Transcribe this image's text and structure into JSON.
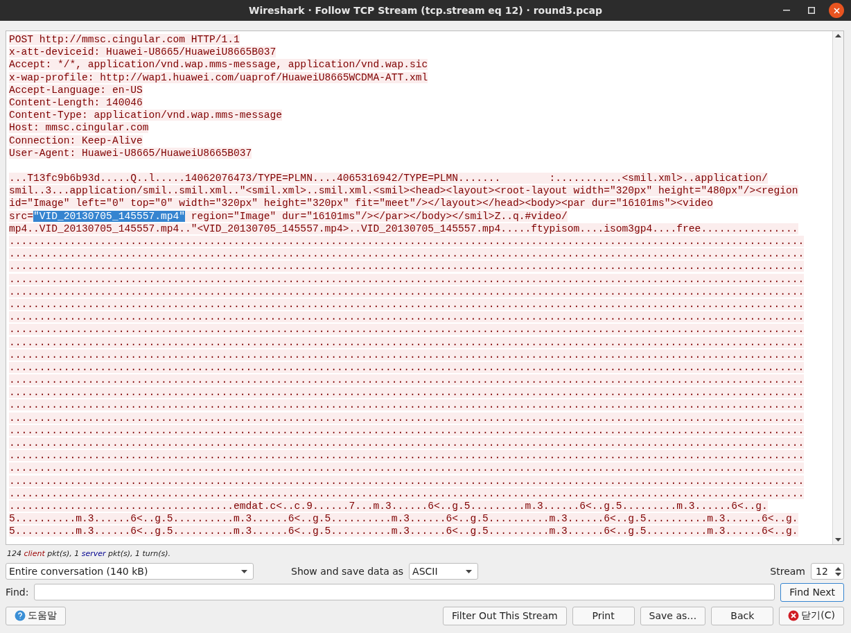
{
  "window": {
    "title": "Wireshark · Follow TCP Stream (tcp.stream eq 12) · round3.pcap"
  },
  "stream_lines": [
    {
      "parts": [
        {
          "text": "POST http://mmsc.cingular.com HTTP/1.1",
          "selected": false
        }
      ]
    },
    {
      "parts": [
        {
          "text": "x-att-deviceid: Huawei-U8665/HuaweiU8665B037",
          "selected": false
        }
      ]
    },
    {
      "parts": [
        {
          "text": "Accept: */*, application/vnd.wap.mms-message, application/vnd.wap.sic",
          "selected": false
        }
      ]
    },
    {
      "parts": [
        {
          "text": "x-wap-profile: http://wap1.huawei.com/uaprof/HuaweiU8665WCDMA-ATT.xml",
          "selected": false
        }
      ]
    },
    {
      "parts": [
        {
          "text": "Accept-Language: en-US",
          "selected": false
        }
      ]
    },
    {
      "parts": [
        {
          "text": "Content-Length: 140046",
          "selected": false
        }
      ]
    },
    {
      "parts": [
        {
          "text": "Content-Type: application/vnd.wap.mms-message",
          "selected": false
        }
      ]
    },
    {
      "parts": [
        {
          "text": "Host: mmsc.cingular.com",
          "selected": false
        }
      ]
    },
    {
      "parts": [
        {
          "text": "Connection: Keep-Alive",
          "selected": false
        }
      ]
    },
    {
      "parts": [
        {
          "text": "User-Agent: Huawei-U8665/HuaweiU8665B037",
          "selected": false
        }
      ]
    },
    {
      "kind": "blank"
    },
    {
      "parts": [
        {
          "text": "...T13fc9b6b93d.....Q..l.....14062076473/TYPE=PLMN....4065316942/TYPE=PLMN.......        :...........<smil.xml>..application/",
          "selected": false
        }
      ]
    },
    {
      "parts": [
        {
          "text": "smil..3...application/smil..smil.xml..\"<smil.xml>..smil.xml.<smil><head><layout><root-layout width=\"320px\" height=\"480px\"/><region",
          "selected": false
        }
      ]
    },
    {
      "parts": [
        {
          "text": "id=\"Image\" left=\"0\" top=\"0\" width=\"320px\" height=\"320px\" fit=\"meet\"/></layout></head><body><par dur=\"16101ms\"><video",
          "selected": false
        }
      ]
    },
    {
      "parts": [
        {
          "text": "src=",
          "selected": false
        },
        {
          "text": "\"VID_20130705_145557.mp4\"",
          "selected": true
        },
        {
          "text": " region=\"Image\" dur=\"16101ms\"/></par></body></smil>Z..q.#video/",
          "selected": false
        }
      ]
    },
    {
      "parts": [
        {
          "text": "mp4..VID_20130705_145557.mp4..\"<VID_20130705_145557.mp4>..VID_20130705_145557.mp4.....ftypisom....isom3gp4....free................",
          "selected": false
        }
      ]
    },
    {
      "parts": [
        {
          "text": "...................................................................................................................................",
          "selected": false
        }
      ]
    },
    {
      "parts": [
        {
          "text": "...................................................................................................................................",
          "selected": false
        }
      ]
    },
    {
      "parts": [
        {
          "text": "...................................................................................................................................",
          "selected": false
        }
      ]
    },
    {
      "parts": [
        {
          "text": "...................................................................................................................................",
          "selected": false
        }
      ]
    },
    {
      "parts": [
        {
          "text": "...................................................................................................................................",
          "selected": false
        }
      ]
    },
    {
      "parts": [
        {
          "text": "...................................................................................................................................",
          "selected": false
        }
      ]
    },
    {
      "parts": [
        {
          "text": "...................................................................................................................................",
          "selected": false
        }
      ]
    },
    {
      "parts": [
        {
          "text": "...................................................................................................................................",
          "selected": false
        }
      ]
    },
    {
      "parts": [
        {
          "text": "...................................................................................................................................",
          "selected": false
        }
      ]
    },
    {
      "parts": [
        {
          "text": "...................................................................................................................................",
          "selected": false
        }
      ]
    },
    {
      "parts": [
        {
          "text": "...................................................................................................................................",
          "selected": false
        }
      ]
    },
    {
      "parts": [
        {
          "text": "...................................................................................................................................",
          "selected": false
        }
      ]
    },
    {
      "parts": [
        {
          "text": "...................................................................................................................................",
          "selected": false
        }
      ]
    },
    {
      "parts": [
        {
          "text": "...................................................................................................................................",
          "selected": false
        }
      ]
    },
    {
      "parts": [
        {
          "text": "...................................................................................................................................",
          "selected": false
        }
      ]
    },
    {
      "parts": [
        {
          "text": "...................................................................................................................................",
          "selected": false
        }
      ]
    },
    {
      "parts": [
        {
          "text": "...................................................................................................................................",
          "selected": false
        }
      ]
    },
    {
      "parts": [
        {
          "text": "...................................................................................................................................",
          "selected": false
        }
      ]
    },
    {
      "parts": [
        {
          "text": "...................................................................................................................................",
          "selected": false
        }
      ]
    },
    {
      "parts": [
        {
          "text": "...................................................................................................................................",
          "selected": false
        }
      ]
    },
    {
      "parts": [
        {
          "text": "...................................................................................................................................",
          "selected": false
        }
      ]
    },
    {
      "parts": [
        {
          "text": ".....................................emdat.c<..c.9......7...m.3......6<..g.5.........m.3......6<..g.5.........m.3......6<..g.",
          "selected": false
        }
      ]
    },
    {
      "parts": [
        {
          "text": "5..........m.3......6<..g.5..........m.3......6<..g.5..........m.3......6<..g.5..........m.3......6<..g.5..........m.3......6<..g.",
          "selected": false
        }
      ]
    },
    {
      "parts": [
        {
          "text": "5..........m.3......6<..g.5..........m.3......6<..g.5..........m.3......6<..g.5..........m.3......6<..g.5..........m.3......6<..g.",
          "selected": false
        }
      ]
    }
  ],
  "summary": [
    {
      "text": "124 ",
      "kind": "plain"
    },
    {
      "text": "client",
      "kind": "client"
    },
    {
      "text": " pkt(s), 1 ",
      "kind": "plain"
    },
    {
      "text": "server",
      "kind": "server"
    },
    {
      "text": " pkt(s), 1 turn(s).",
      "kind": "plain"
    }
  ],
  "conversation_select": {
    "value": "Entire conversation (140 kB)"
  },
  "data_format": {
    "label": "Show and save data as",
    "value": "ASCII"
  },
  "stream": {
    "label": "Stream",
    "value": "12"
  },
  "find": {
    "label": "Find:",
    "button": "Find Next"
  },
  "help_button": "도움말",
  "buttons": [
    "Filter Out This Stream",
    "Print",
    "Save as…",
    "Back"
  ],
  "close_button": "닫기(C)"
}
